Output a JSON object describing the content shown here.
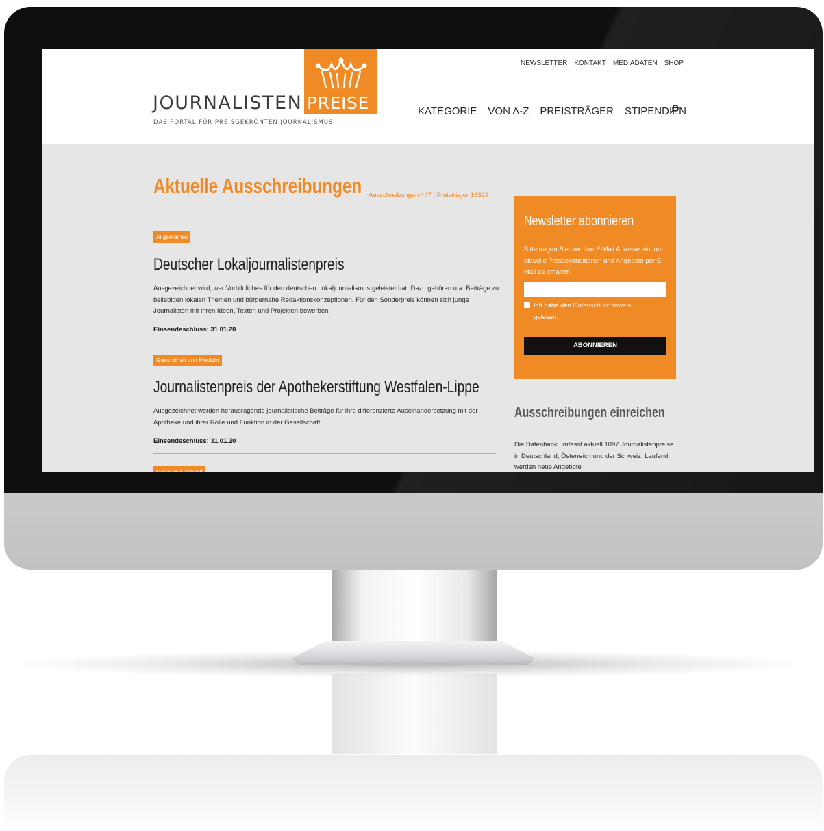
{
  "header": {
    "logo": {
      "word_a": "JOURNALISTEN",
      "word_b": "PREISE",
      "tagline": "DAS PORTAL FÜR PREISGEKRÖNTEN JOURNALISMUS",
      "icon": "crown-icon"
    },
    "top_nav": [
      "NEWSLETTER",
      "KONTAKT",
      "MEDIADATEN",
      "SHOP"
    ],
    "main_nav": [
      "KATEGORIE",
      "VON A-Z",
      "PREISTRÄGER",
      "STIPENDIEN"
    ],
    "search_icon": "search-icon"
  },
  "main": {
    "title": "Aktuelle Ausschreibungen",
    "stats": "Ausschreibungen 447 | Preisträger 16329",
    "articles": [
      {
        "category": "Allgemeines",
        "title": "Deutscher Lokaljournalistenpreis",
        "description": "Ausgezeichnet wird, wer Vorbildliches für den deutschen Lokaljournalismus geleistet hat. Dazu gehören u.a. Beiträge zu beliebigen lokalen Themen und bürgernahe Redaktionskonzeptionen. Für den Sonderpreis können sich junge Journalisten mit ihren Ideen, Texten und Projekten bewerben.",
        "deadline": "Einsendeschluss: 31.01.20"
      },
      {
        "category": "Gesundheit und Medizin",
        "title": "Journalistenpreis der Apothekerstiftung Westfalen-Lippe",
        "description": "Ausgezeichnet werden herausragende journalistische Beiträge für ihre differenzierte Auseinandersetzung mit der Apotheke und ihrer Rolle und Funktion in der Gesellschaft.",
        "deadline": "Einsendeschluss: 31.01.20"
      },
      {
        "category": "Natur und Umwelt"
      }
    ]
  },
  "sidebar": {
    "newsletter": {
      "title": "Newsletter abonnieren",
      "text": "Bitte tragen Sie hier Ihre E-Mail Adresse ein, um aktuelle Pressekonditionen und Angebote per E-Mail zu erhalten.",
      "email_value": "",
      "consent_prefix": "Ich habe den",
      "consent_link": "Datenschutzhinweis",
      "consent_suffix": "gelesen.",
      "button": "ABONNIEREN"
    },
    "submit": {
      "title": "Ausschreibungen einreichen",
      "text": "Die Datenbank umfasst aktuell 1097 Journalistenpreise in Deutschland, Österreich und der Schweiz. Laufend werden neue Angebote"
    }
  },
  "colors": {
    "accent": "#f08a24",
    "background": "#e6e6e6",
    "button": "#111111"
  }
}
